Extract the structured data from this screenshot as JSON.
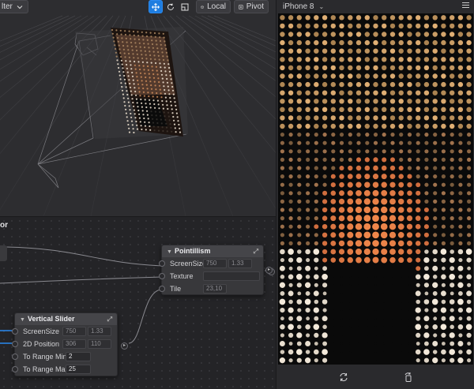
{
  "toolbar": {
    "filter_label": "lter",
    "move_tool": "move-icon",
    "rotate_tool": "rotate-icon",
    "scale_tool": "scale-icon",
    "local_label": "Local",
    "pivot_label": "Pivot"
  },
  "editor": {
    "title": "or",
    "nodes": {
      "pointillism": {
        "title": "Pointillism",
        "rows": {
          "screen_size": {
            "label": "ScreenSize",
            "v1": "750",
            "v2": "1.33"
          },
          "texture": {
            "label": "Texture"
          },
          "tile": {
            "label": "Tile",
            "v1": "23,10"
          }
        }
      },
      "vertical_slider": {
        "title": "Vertical Slider",
        "rows": {
          "screen_size": {
            "label": "ScreenSize",
            "v1": "750",
            "v2": "1.33"
          },
          "position": {
            "label": "2D Position",
            "v1": "306",
            "v2": "110"
          },
          "range_min": {
            "label": "To Range Min",
            "v1": "2"
          },
          "range_max": {
            "label": "To Range Max",
            "v1": "25"
          }
        }
      }
    }
  },
  "preview": {
    "device": "iPhone 8",
    "footer_left_icon": "refresh-icon",
    "footer_right_icon": "rotate-device-icon"
  },
  "colors": {
    "accent": "#1e7de0",
    "panel": "#2b2b2e",
    "editor_bg": "#242427"
  }
}
